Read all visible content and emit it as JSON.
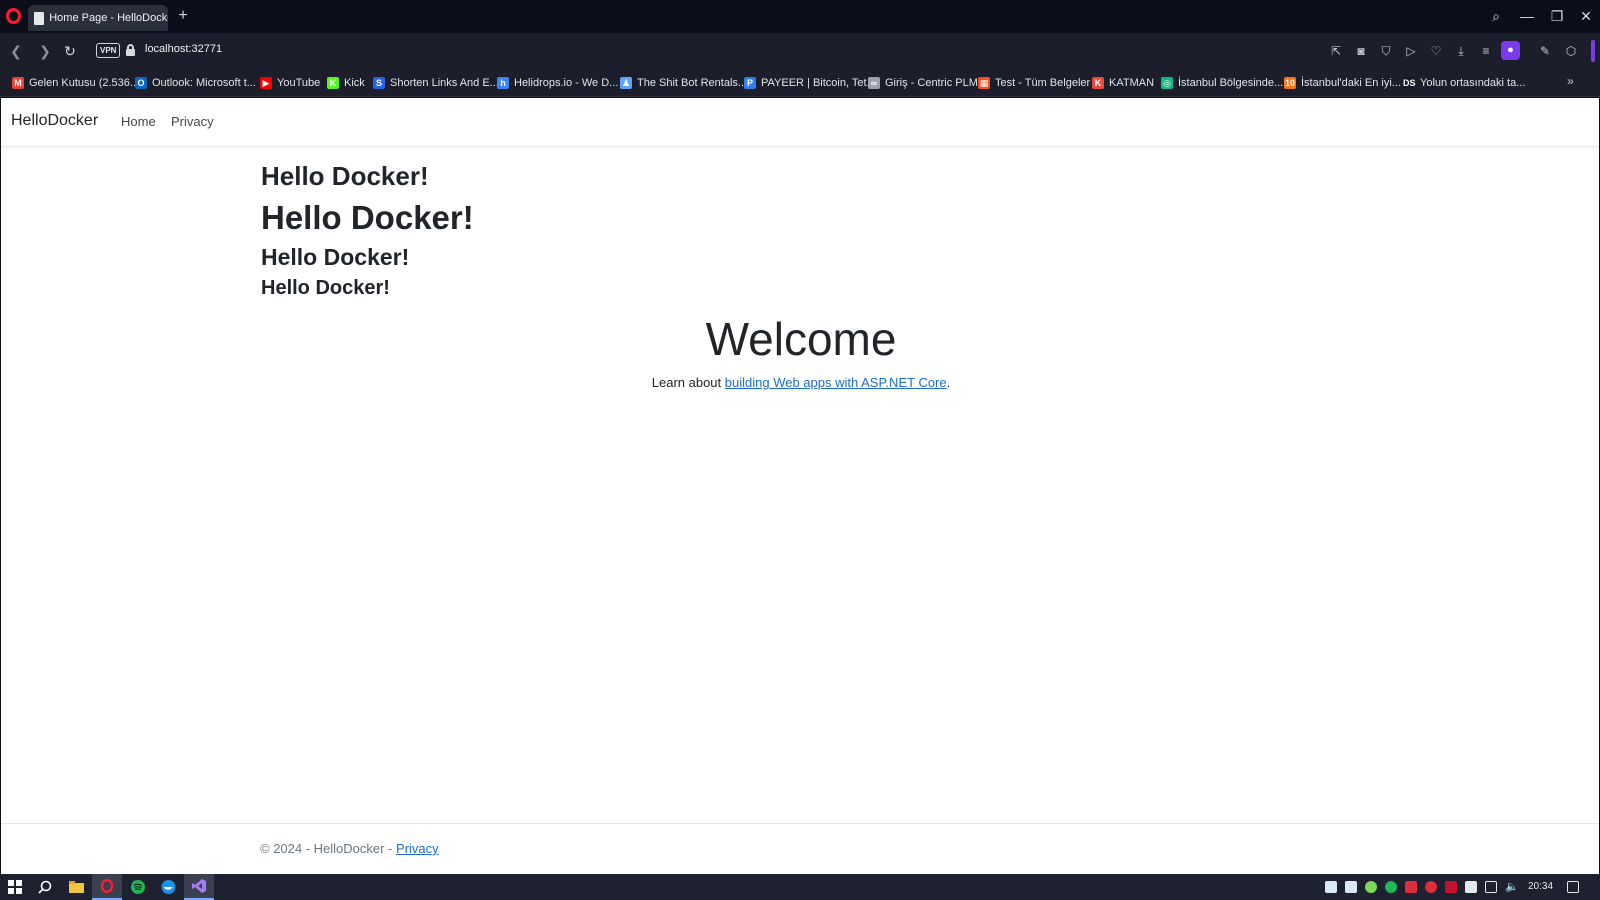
{
  "browser": {
    "tab_title": "Home Page - HelloDocker",
    "new_tab_symbol": "+",
    "url": "localhost:32771",
    "vpn_label": "VPN",
    "bookmarks": [
      {
        "label": "Gelen Kutusu (2.536...",
        "icon_color": "#ea4335",
        "icon_text": "M"
      },
      {
        "label": "Outlook: Microsoft t...",
        "icon_color": "#0a64c8",
        "icon_text": "O"
      },
      {
        "label": "YouTube",
        "icon_color": "#ff0000",
        "icon_text": "▶"
      },
      {
        "label": "Kick",
        "icon_color": "#53fc18",
        "icon_text": "K"
      },
      {
        "label": "Shorten Links And E...",
        "icon_color": "#2563eb",
        "icon_text": "S"
      },
      {
        "label": "Helidrops.io - We D...",
        "icon_color": "#3b82f6",
        "icon_text": "h"
      },
      {
        "label": "The Shit Bot Rentals...",
        "icon_color": "#60a5fa",
        "icon_text": "♟"
      },
      {
        "label": "PAYEER | Bitcoin, Tet...",
        "icon_color": "#2f80ed",
        "icon_text": "P"
      },
      {
        "label": "Giriş - Centric PLM",
        "icon_color": "#9ca3af",
        "icon_text": "∞"
      },
      {
        "label": "Test - Tüm Belgeler",
        "icon_color": "#f25022",
        "icon_text": "▦"
      },
      {
        "label": "KATMAN",
        "icon_color": "#e74c3c",
        "icon_text": "K"
      },
      {
        "label": "İstanbul Bölgesinde...",
        "icon_color": "#10b981",
        "icon_text": "◎"
      },
      {
        "label": "İstanbul'daki En iyi...",
        "icon_color": "#f97316",
        "icon_text": "10"
      },
      {
        "label": "Yolun ortasındaki ta...",
        "icon_color": "#111827",
        "icon_text": "DS"
      }
    ]
  },
  "site": {
    "brand": "HelloDocker",
    "nav": [
      {
        "label": "Home"
      },
      {
        "label": "Privacy"
      }
    ],
    "headings": [
      "Hello Docker!",
      "Hello Docker!",
      "Hello Docker!",
      "Hello Docker!"
    ],
    "welcome": "Welcome",
    "learn_prefix": "Learn about ",
    "learn_link": "building Web apps with ASP.NET Core",
    "learn_suffix": ".",
    "footer_text": "© 2024 - HelloDocker - ",
    "footer_link": "Privacy"
  },
  "taskbar": {
    "clock": "20:34"
  }
}
